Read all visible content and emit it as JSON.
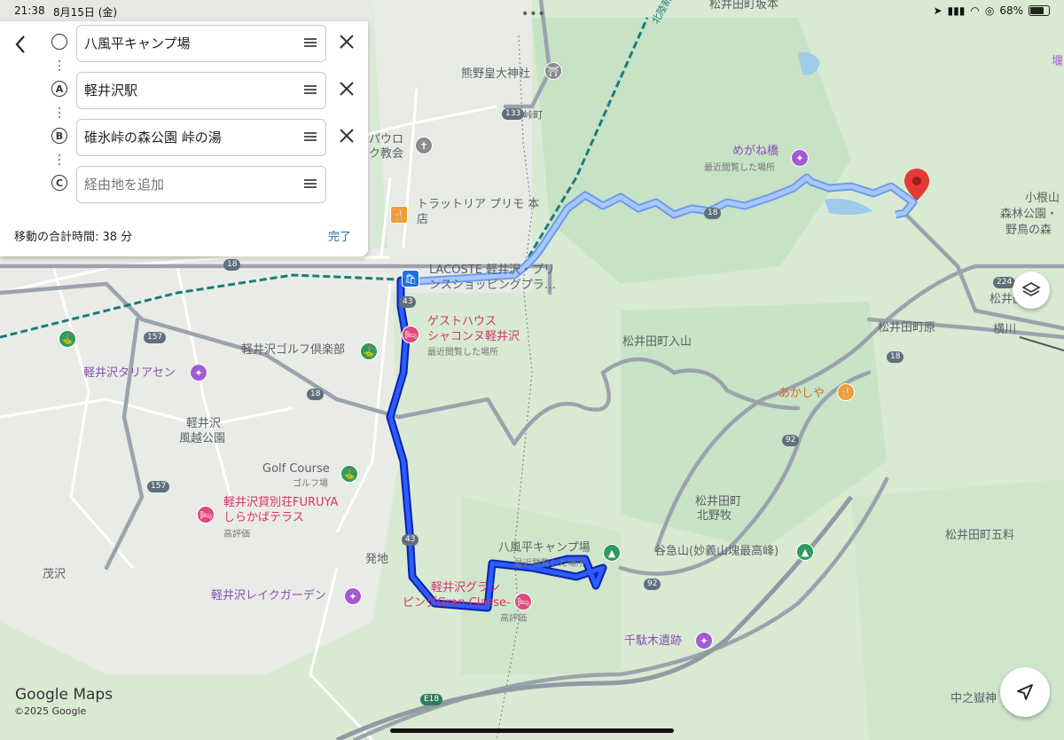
{
  "status_bar": {
    "time": "21:38",
    "date": "8月15日 (金)",
    "battery": "68%"
  },
  "directions_panel": {
    "stops": [
      {
        "marker": "",
        "value": "八風平キャンプ場",
        "placeholder": ""
      },
      {
        "marker": "A",
        "value": "軽井沢駅",
        "placeholder": ""
      },
      {
        "marker": "B",
        "value": "碓氷峠の森公園 峠の湯",
        "placeholder": ""
      },
      {
        "marker": "C",
        "value": "",
        "placeholder": "経由地を追加"
      }
    ],
    "total_time": "移動の合計時間: 38 分",
    "done_label": "完了"
  },
  "map": {
    "labels": {
      "kumano": "熊野皇大神社",
      "togemachi": "峠町",
      "pauro": "パウロ",
      "kyokai": "ク教会",
      "trattoria1": "トラットリア プリモ 本",
      "trattoria2": "店",
      "lacoste1": "LACOSTE 軽井沢・プリ",
      "lacoste2": "ンスショッピングプラ…",
      "guesthouse1": "ゲストハウス",
      "guesthouse2": "シャコンヌ軽井沢",
      "guesthouse_sub": "最近閲覧した場所",
      "golfclub": "軽井沢ゴルフ倶楽部",
      "taliesin": "軽井沢タリアセン",
      "fuetsu1": "軽井沢",
      "fuetsu2": "風越公園",
      "golfcourse": "Golf Course",
      "golfcourse_sub": "ゴルフ場",
      "furuya1": "軽井沢貸別荘FURUYA",
      "furuya2": "しらかばテラス",
      "furuya_sub": "高評価",
      "hatchi": "発地",
      "moshizawa": "茂沢",
      "lakegarden": "軽井沢レイクガーデン",
      "granclasse1": "軽井沢グラン",
      "granclasse2": "ピングGran Classe-",
      "granclasse_sub": "高評価",
      "camp": "八風平キャンプ場",
      "camp_sub": "最近閲覧した場所",
      "meganebashi": "めがね橋",
      "meganebashi_sub": "最近閲覧した場所",
      "kitanoshimo": "松井田町坂本",
      "iriyama": "松井田町入山",
      "akashiya": "あかしや",
      "kitanomaki1": "松井田町",
      "kitanomaki2": "北野牧",
      "tanzan": "谷急山(妙義山塊最高峰)",
      "sendagi": "千駄木遺跡",
      "gokou": "松井田町五料",
      "nakanotake": "中之嶽神",
      "matsuida_town": "松井田町原",
      "yokokawa": "横川",
      "matsuida_station": "松井田",
      "koneyama1": "小根山",
      "koneyama2": "森林公園・",
      "koneyama3": "野鳥の森",
      "hokuriku": "北陸新",
      "right_edge": "堰"
    },
    "road_shields": [
      "18",
      "133",
      "43",
      "157",
      "92",
      "224",
      "E18"
    ],
    "route_color": "#1a3be0",
    "alt_route_color": "#8ab4f8"
  },
  "branding": {
    "logo": "Google Maps",
    "copyright": "©2025 Google"
  }
}
